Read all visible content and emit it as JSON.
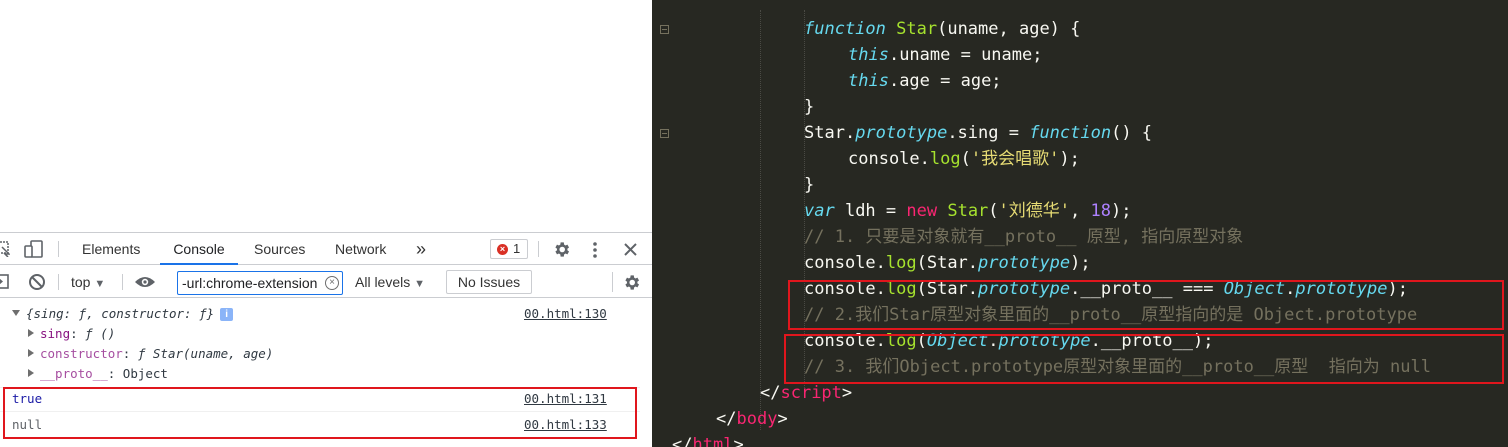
{
  "devtools": {
    "tabs": [
      "Elements",
      "Console",
      "Sources",
      "Network"
    ],
    "active_tab": "Console",
    "more_tabs_glyph": "»",
    "error_count": "1",
    "context": "top",
    "filter_value": "-url:chrome-extension",
    "levels_label": "All levels",
    "issues_label": "No Issues",
    "icons": [
      "inspect-icon",
      "device-icon",
      "error-icon",
      "gear-icon",
      "kebab-icon",
      "close-icon",
      "sidebar-icon",
      "clear-icon",
      "eye-icon",
      "clear-filter-icon",
      "settings-gear-icon",
      "dropdown-icon"
    ],
    "accent_color": "#1a73e8",
    "highlight_color": "#e0161d"
  },
  "console": {
    "object_summary": "{sing: ƒ, constructor: ƒ}",
    "object_src": "00.html:130",
    "info_glyph": "i",
    "props": [
      {
        "key": "sing",
        "value": "ƒ ()"
      },
      {
        "key": "constructor",
        "value": "ƒ Star(uname, age)"
      },
      {
        "key": "__proto__",
        "value": "Object"
      }
    ],
    "rows": [
      {
        "text": "true",
        "src": "00.html:131"
      },
      {
        "text": "null",
        "src": "00.html:133"
      }
    ]
  },
  "editor": {
    "lines": {
      "l1_kw": "function",
      "l1_name": "Star",
      "l1_rest": "(uname, age) {",
      "l2_this": "this",
      "l2_rest": ".uname = uname;",
      "l3_this": "this",
      "l3_rest": ".age = age;",
      "l4": "}",
      "l5_a": "Star.",
      "l5_proto": "prototype",
      "l5_b": ".sing = ",
      "l5_kw": "function",
      "l5_c": "() {",
      "l6_a": "console.",
      "l6_fn": "log",
      "l6_b": "(",
      "l6_str": "'我会唱歌'",
      "l6_c": ");",
      "l7": "}",
      "l8_var": "var",
      "l8_a": " ldh = ",
      "l8_new": "new",
      "l8_b": " ",
      "l8_star": "Star",
      "l8_c": "(",
      "l8_str": "'刘德华'",
      "l8_d": ", ",
      "l8_num": "18",
      "l8_e": ");",
      "l9": "// 1. 只要是对象就有__proto__ 原型, 指向原型对象",
      "l10_a": "console.",
      "l10_fn": "log",
      "l10_b": "(Star.",
      "l10_proto": "prototype",
      "l10_c": ");",
      "l11_a": "console.",
      "l11_fn": "log",
      "l11_b": "(Star.",
      "l11_proto": "prototype",
      "l11_c": ".__proto__ === ",
      "l11_obj": "Object",
      "l11_d": ".",
      "l11_proto2": "prototype",
      "l11_e": ");",
      "l12": "// 2.我们Star原型对象里面的__proto__原型指向的是 Object.prototype",
      "l13_a": "console.",
      "l13_fn": "log",
      "l13_b": "(",
      "l13_obj": "Object",
      "l13_c": ".",
      "l13_proto": "prototype",
      "l13_d": ".__proto__);",
      "l14": "// 3. 我们Object.prototype原型对象里面的__proto__原型  指向为 null",
      "l15_a": "</",
      "l15_tag": "script",
      "l15_b": ">",
      "l16_a": "</",
      "l16_tag": "body",
      "l16_b": ">",
      "l17_a": "</",
      "l17_tag": "html",
      "l17_b": ">"
    }
  }
}
